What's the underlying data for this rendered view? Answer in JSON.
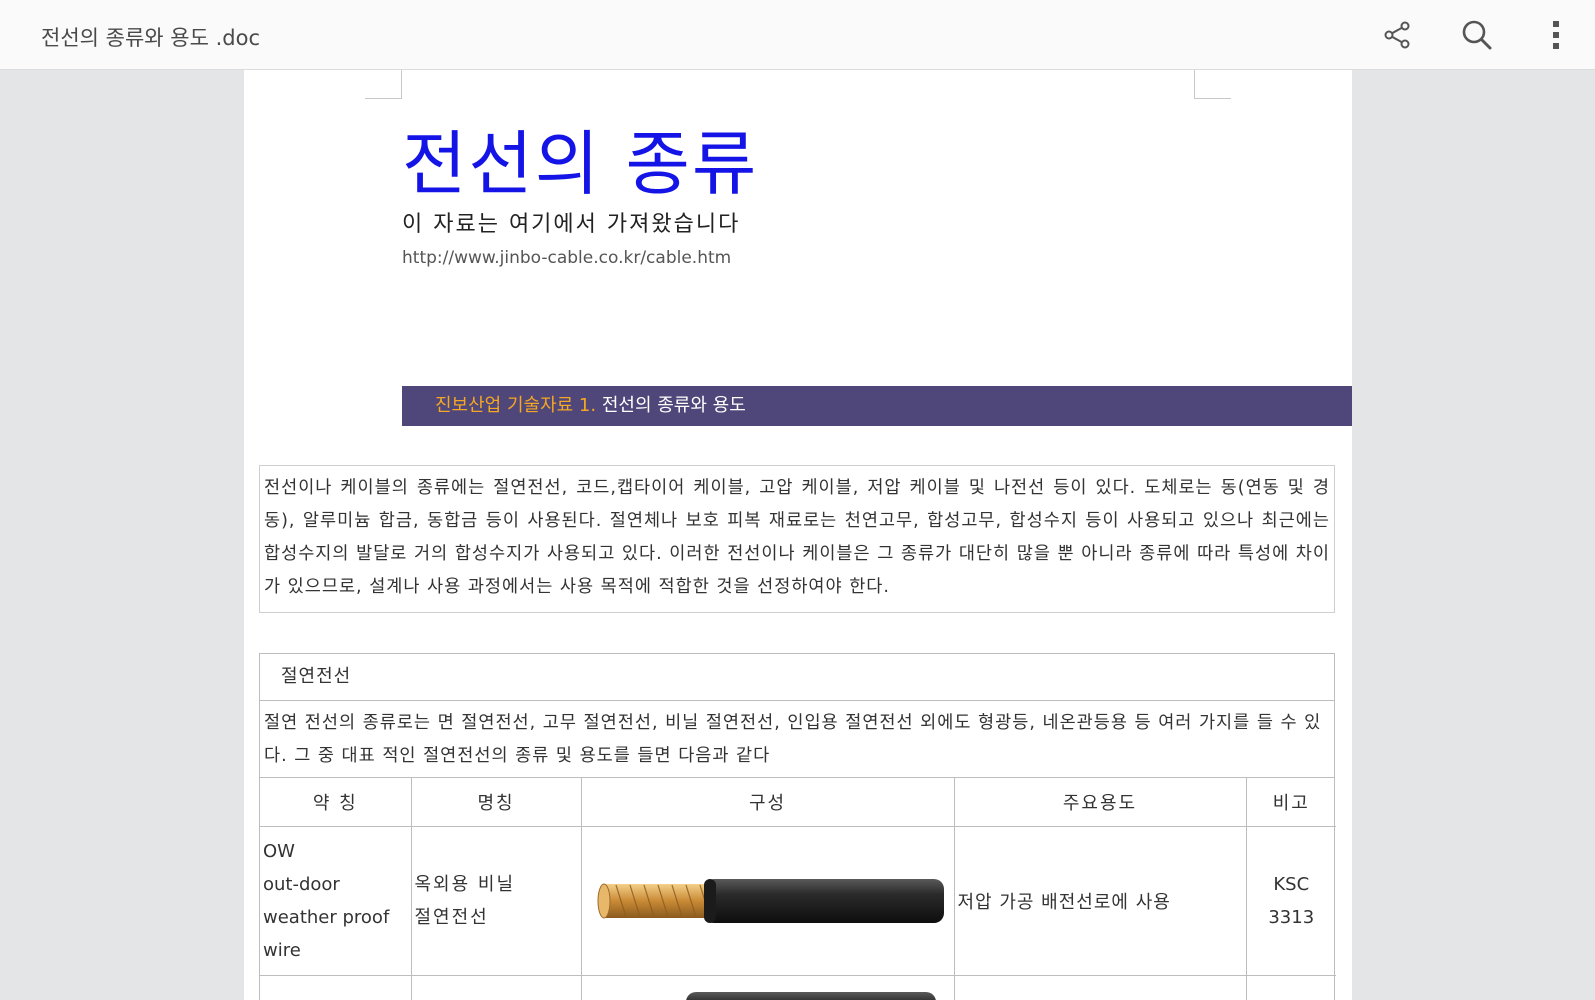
{
  "appbar": {
    "title": "전선의 종류와 용도 .doc",
    "icons": [
      "share-icon",
      "search-icon",
      "more-vert-icon"
    ]
  },
  "doc": {
    "title": "전선의 종류",
    "subtitle": "이 자료는 여기에서 가져왔습니다",
    "url": "http://www.jinbo-cable.co.kr/cable.htm",
    "banner": {
      "accent": "진보산업 기술자료 1.",
      "text": " 전선의 종류와 용도"
    },
    "intro": "전선이나 케이블의 종류에는 절연전선, 코드,캡타이어 케이블, 고압 케이블, 저압 케이블 및 나전선 등이 있다. 도체로는 동(연동 및 경동), 알루미늄 합금, 동합금 등이 사용된다. 절연체나 보호 피복 재료로는 천연고무, 합성고무, 합성수지 등이 사용되고 있으나 최근에는 합성수지의 발달로 거의 합성수지가 사용되고 있다. 이러한 전선이나 케이블은 그 종류가 대단히 많을 뿐 아니라 종류에 따라 특성에 차이가 있으므로, 설계나 사용 과정에서는 사용 목적에 적합한 것을 선정하여야 한다.",
    "section": {
      "heading": "절연전선",
      "description": "절연 전선의 종류로는 면 절연전선, 고무 절연전선, 비닐 절연전선, 인입용 절연전선 외에도 형광등, 네온관등용 등 여러 가지를 들 수 있다. 그 중 대표 적인 절연전선의 종류 및 용도를 들면 다음과 같다",
      "columns": [
        "약 칭",
        "명칭",
        "구성",
        "주요용도",
        "비고"
      ],
      "rows": [
        {
          "abbr": [
            "OW",
            "out-door",
            "weather proof",
            "wire"
          ],
          "name": [
            "옥외용 비닐",
            "절연전선"
          ],
          "use": "저압 가공 배전선로에 사용",
          "note": [
            "KSC",
            "3313"
          ]
        }
      ]
    }
  },
  "colors": {
    "title_blue": "#1414e6",
    "banner_bg": "#4f4679",
    "banner_accent": "#f5a623"
  }
}
